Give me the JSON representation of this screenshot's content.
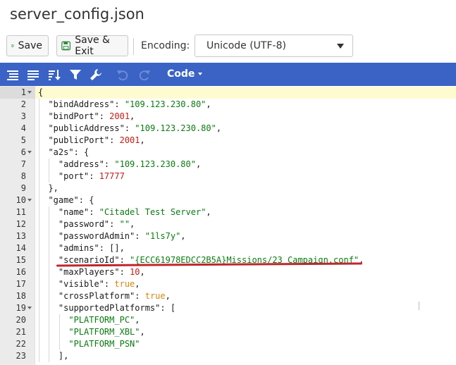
{
  "window": {
    "title": "server_config.json"
  },
  "toolbar": {
    "save_label": "Save",
    "save_exit_label": "Save & Exit",
    "encoding_label": "Encoding:",
    "encoding_value": "Unicode (UTF-8)"
  },
  "editor_menu": {
    "icons": [
      "format-icon",
      "compact-icon",
      "sort-icon",
      "filter-icon",
      "repair-icon",
      "undo-icon",
      "redo-icon"
    ],
    "mode_label": "Code",
    "bar_color": "#3a63c5"
  },
  "colors": {
    "string": "#0b7a11",
    "number": "#c41a16",
    "boolean": "#d9840e",
    "highlight": "#c0262d"
  },
  "code_lines": [
    {
      "n": "1",
      "fold": true,
      "indent": 0,
      "parts": [
        [
          "p",
          "{"
        ]
      ]
    },
    {
      "n": "2",
      "indent": 1,
      "parts": [
        [
          "k",
          "\"bindAddress\""
        ],
        [
          "p",
          ": "
        ],
        [
          "s",
          "\"109.123.230.80\""
        ],
        [
          "p",
          ","
        ]
      ]
    },
    {
      "n": "3",
      "indent": 1,
      "parts": [
        [
          "k",
          "\"bindPort\""
        ],
        [
          "p",
          ": "
        ],
        [
          "n",
          "2001"
        ],
        [
          "p",
          ","
        ]
      ]
    },
    {
      "n": "4",
      "indent": 1,
      "parts": [
        [
          "k",
          "\"publicAddress\""
        ],
        [
          "p",
          ": "
        ],
        [
          "s",
          "\"109.123.230.80\""
        ],
        [
          "p",
          ","
        ]
      ]
    },
    {
      "n": "5",
      "indent": 1,
      "parts": [
        [
          "k",
          "\"publicPort\""
        ],
        [
          "p",
          ": "
        ],
        [
          "n",
          "2001"
        ],
        [
          "p",
          ","
        ]
      ]
    },
    {
      "n": "6",
      "fold": true,
      "indent": 1,
      "parts": [
        [
          "k",
          "\"a2s\""
        ],
        [
          "p",
          ": {"
        ]
      ]
    },
    {
      "n": "7",
      "indent": 2,
      "parts": [
        [
          "k",
          "\"address\""
        ],
        [
          "p",
          ": "
        ],
        [
          "s",
          "\"109.123.230.80\""
        ],
        [
          "p",
          ","
        ]
      ]
    },
    {
      "n": "8",
      "indent": 2,
      "parts": [
        [
          "k",
          "\"port\""
        ],
        [
          "p",
          ": "
        ],
        [
          "n",
          "17777"
        ]
      ]
    },
    {
      "n": "9",
      "indent": 1,
      "parts": [
        [
          "p",
          "},"
        ]
      ]
    },
    {
      "n": "10",
      "fold": true,
      "indent": 1,
      "parts": [
        [
          "k",
          "\"game\""
        ],
        [
          "p",
          ": {"
        ]
      ]
    },
    {
      "n": "11",
      "indent": 2,
      "parts": [
        [
          "k",
          "\"name\""
        ],
        [
          "p",
          ": "
        ],
        [
          "s",
          "\"Citadel Test Server\""
        ],
        [
          "p",
          ","
        ]
      ]
    },
    {
      "n": "12",
      "indent": 2,
      "parts": [
        [
          "k",
          "\"password\""
        ],
        [
          "p",
          ": "
        ],
        [
          "s",
          "\"\""
        ],
        [
          "p",
          ","
        ]
      ]
    },
    {
      "n": "13",
      "indent": 2,
      "parts": [
        [
          "k",
          "\"passwordAdmin\""
        ],
        [
          "p",
          ": "
        ],
        [
          "s",
          "\"1ls7y\""
        ],
        [
          "p",
          ","
        ]
      ]
    },
    {
      "n": "14",
      "indent": 2,
      "parts": [
        [
          "k",
          "\"admins\""
        ],
        [
          "p",
          ": [],"
        ]
      ]
    },
    {
      "n": "15",
      "indent": 2,
      "parts": [
        [
          "k",
          "\"scenarioId\""
        ],
        [
          "p",
          ": "
        ],
        [
          "s",
          "\"{ECC61978EDCC2B5A}Missions/23_Campaign.conf\""
        ],
        [
          "p",
          ","
        ]
      ]
    },
    {
      "n": "16",
      "indent": 2,
      "parts": [
        [
          "k",
          "\"maxPlayers\""
        ],
        [
          "p",
          ": "
        ],
        [
          "n",
          "10"
        ],
        [
          "p",
          ","
        ]
      ]
    },
    {
      "n": "17",
      "indent": 2,
      "parts": [
        [
          "k",
          "\"visible\""
        ],
        [
          "p",
          ": "
        ],
        [
          "b",
          "true"
        ],
        [
          "p",
          ","
        ]
      ]
    },
    {
      "n": "18",
      "indent": 2,
      "parts": [
        [
          "k",
          "\"crossPlatform\""
        ],
        [
          "p",
          ": "
        ],
        [
          "b",
          "true"
        ],
        [
          "p",
          ","
        ]
      ]
    },
    {
      "n": "19",
      "fold": true,
      "indent": 2,
      "parts": [
        [
          "k",
          "\"supportedPlatforms\""
        ],
        [
          "p",
          ": ["
        ]
      ]
    },
    {
      "n": "20",
      "indent": 3,
      "parts": [
        [
          "s",
          "\"PLATFORM_PC\""
        ],
        [
          "p",
          ","
        ]
      ]
    },
    {
      "n": "21",
      "indent": 3,
      "parts": [
        [
          "s",
          "\"PLATFORM_XBL\""
        ],
        [
          "p",
          ","
        ]
      ]
    },
    {
      "n": "22",
      "indent": 3,
      "parts": [
        [
          "s",
          "\"PLATFORM_PSN\""
        ]
      ]
    },
    {
      "n": "23",
      "indent": 2,
      "parts": [
        [
          "p",
          "],"
        ]
      ]
    }
  ]
}
